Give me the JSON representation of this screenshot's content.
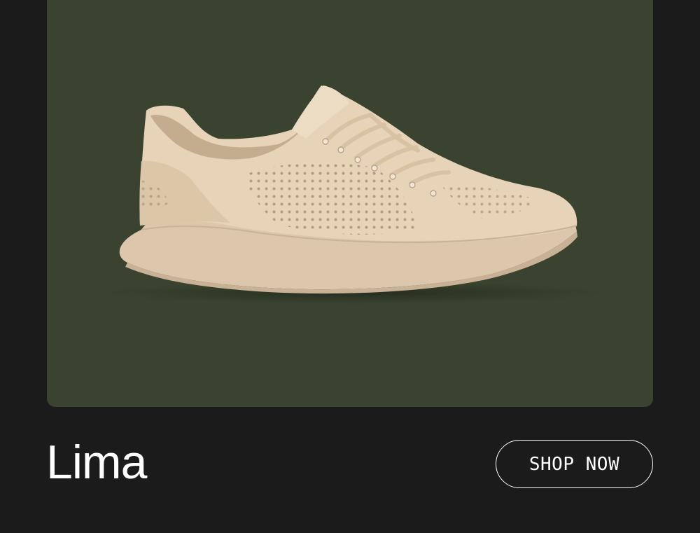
{
  "product": {
    "name": "Lima",
    "cta_label": "SHOP NOW",
    "image_icon": "sneaker-image",
    "colors": {
      "page_background": "#1b1b1b",
      "image_background": "#3a4330",
      "shoe": "#e6d3b8",
      "text": "#ffffff"
    }
  }
}
